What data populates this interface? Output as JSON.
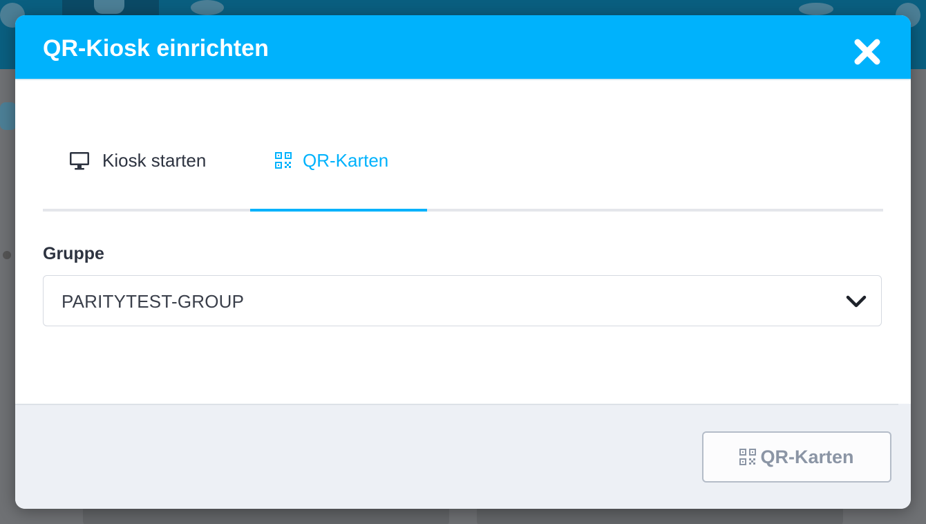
{
  "modal": {
    "title": "QR-Kiosk einrichten",
    "close_icon": "close-icon"
  },
  "tabs": [
    {
      "label": "Kiosk starten",
      "icon": "monitor-icon",
      "active": false
    },
    {
      "label": "QR-Karten",
      "icon": "qr-code-icon",
      "active": true
    }
  ],
  "group": {
    "label": "Gruppe",
    "selected": "PARITYTEST-GROUP",
    "chevron_icon": "chevron-down-icon"
  },
  "footer": {
    "button_label": "QR-Karten",
    "button_icon": "qr-code-icon",
    "button_enabled": false
  },
  "colors": {
    "accent": "#00b2fc",
    "text_dark": "#2d3340",
    "footer_bg": "#edf0f5",
    "disabled_text": "#8b95a5"
  }
}
